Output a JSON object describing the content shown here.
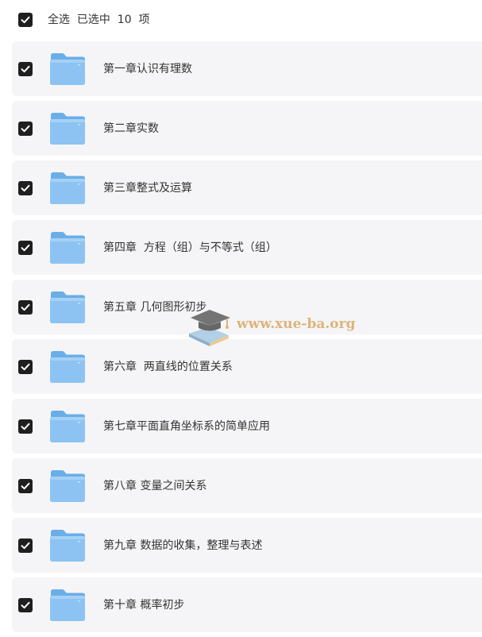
{
  "header": {
    "select_all_text": "全选  已选中  10  项"
  },
  "folders": [
    {
      "name": "第一章认识有理数",
      "checked": true
    },
    {
      "name": "第二章实数",
      "checked": true
    },
    {
      "name": "第三章整式及运算",
      "checked": true
    },
    {
      "name": "第四章  方程（组）与不等式（组）",
      "checked": true
    },
    {
      "name": "第五章 几何图形初步",
      "checked": true
    },
    {
      "name": "第六章  两直线的位置关系",
      "checked": true
    },
    {
      "name": "第七章平面直角坐标系的简单应用",
      "checked": true
    },
    {
      "name": "第八章 变量之间关系",
      "checked": true
    },
    {
      "name": "第九章 数据的收集，整理与表述",
      "checked": true
    },
    {
      "name": "第十章 概率初步",
      "checked": true
    }
  ],
  "watermark": {
    "text": "www.xue-ba.org"
  },
  "icons": {
    "checkbox": "checkbox-checked-icon",
    "folder": "folder-icon"
  },
  "colors": {
    "checkbox_fill": "#1f1f1f",
    "row_background": "#f5f5f7",
    "folder_blue": "#8cc3f2",
    "watermark": "#d9a35b"
  }
}
